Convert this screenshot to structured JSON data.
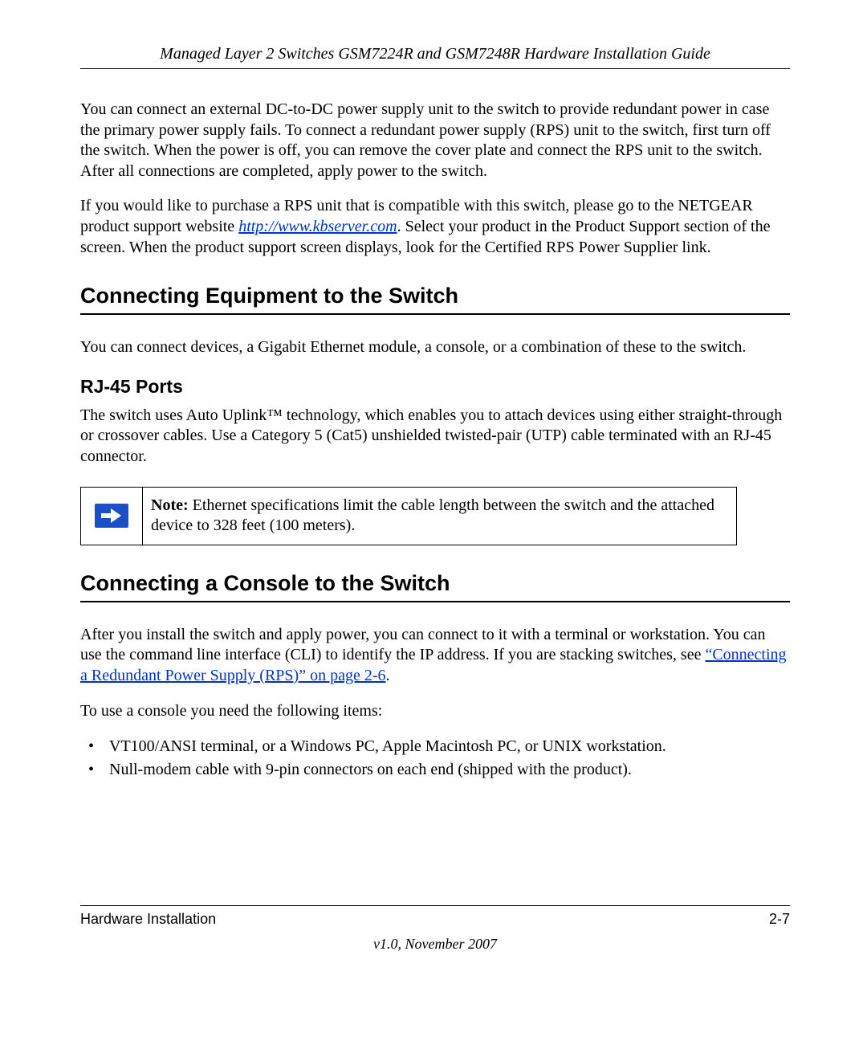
{
  "header": {
    "running_title": "Managed Layer 2 Switches GSM7224R and GSM7248R Hardware Installation Guide"
  },
  "body": {
    "p1": "You can connect an external DC-to-DC power supply unit to the switch to provide redundant power in case the primary power supply fails. To connect a redundant power supply (RPS) unit to the switch, first turn off the switch. When the power is off, you can remove the cover plate and connect the RPS unit to the switch. After all connections are completed, apply power to the switch.",
    "p2_before": "If you would like to purchase a RPS unit that is compatible with this switch, please go to the NETGEAR product support website ",
    "p2_link": "http://www.kbserver.com",
    "p2_after": ". Select your product in the Product Support section of the screen. When the product support screen displays, look for the Certified RPS Power Supplier link.",
    "h1_1": "Connecting Equipment to the Switch",
    "p3": "You can connect devices, a Gigabit Ethernet module, a console, or a combination of these to the switch.",
    "h2_1": "RJ-45 Ports",
    "p4": "The switch uses Auto Uplink™ technology, which enables you to attach devices using either straight-through or crossover cables. Use a Category 5 (Cat5) unshielded twisted-pair (UTP) cable terminated with an RJ-45 connector.",
    "note": {
      "label": "Note:",
      "text": " Ethernet specifications limit the cable length between the switch and the attached device to 328 feet (100 meters)."
    },
    "h1_2": "Connecting a Console to the Switch",
    "p5_before": "After you install the switch and apply power, you can connect to it with a terminal or workstation. You can use the command line interface (CLI) to identify the IP address. If you are stacking switches, see ",
    "p5_link": "“Connecting a Redundant Power Supply (RPS)” on page 2-6",
    "p5_after": ".",
    "p6": "To use a console you need the following items:",
    "bullets": [
      "VT100/ANSI terminal, or a Windows PC, Apple Macintosh PC, or UNIX workstation.",
      "Null-modem cable with 9-pin connectors on each end (shipped with the product)."
    ]
  },
  "footer": {
    "section": "Hardware Installation",
    "page": "2-7",
    "version": "v1.0, November 2007"
  }
}
